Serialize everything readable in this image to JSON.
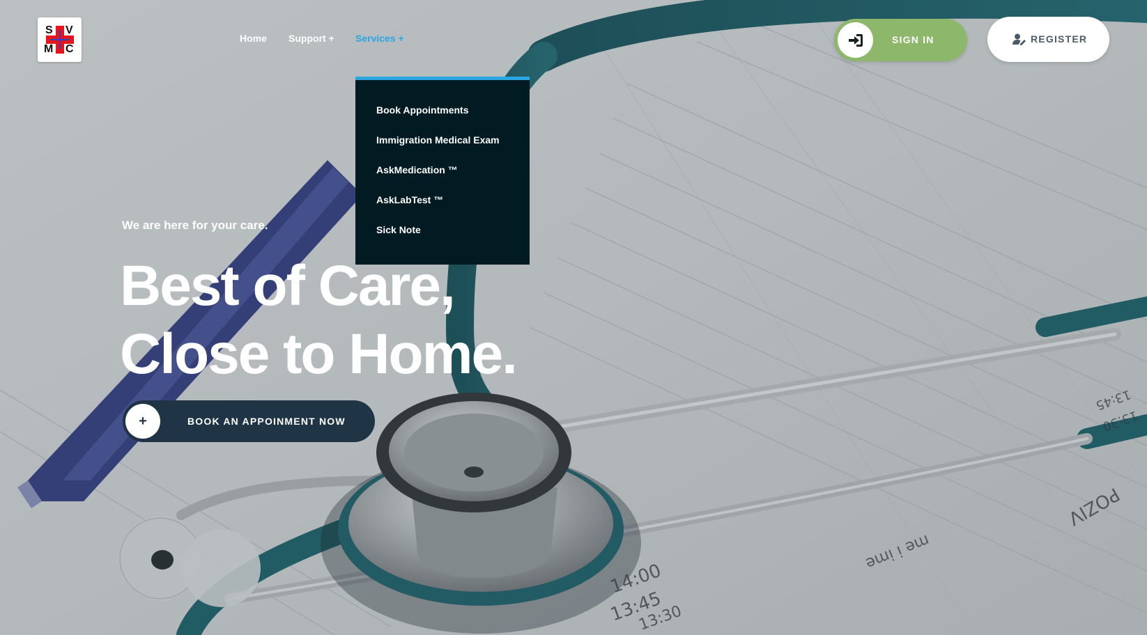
{
  "logo": {
    "letters": [
      "S",
      "V",
      "M",
      "C"
    ]
  },
  "nav": {
    "items": [
      {
        "label": "Home"
      },
      {
        "label": "Support +"
      },
      {
        "label": "Services +"
      }
    ],
    "active_color": "#2aa6e3"
  },
  "services_menu": {
    "items": [
      {
        "label": "Book Appointments"
      },
      {
        "label": "Immigration Medical Exam"
      },
      {
        "label": "AskMedication ™"
      },
      {
        "label": "AskLabTest ™"
      },
      {
        "label": "Sick Note"
      }
    ],
    "background": "#021b23"
  },
  "auth": {
    "signin_label": "SIGN IN",
    "signin_icon": "sign-in-icon",
    "signin_color": "#8db86c",
    "register_label": "REGISTER",
    "register_icon": "user-edit-icon"
  },
  "hero": {
    "tagline": "We are here for your care.",
    "headline_line1": "Best of Care,",
    "headline_line2": "Close to Home.",
    "cta_label": "BOOK AN APPOINMENT NOW",
    "cta_icon_glyph": "+",
    "cta_color": "#1f3445"
  },
  "background_image": {
    "subject": "stethoscope-icon",
    "printed_text": [
      "14:00",
      "13:45",
      "13:30",
      "me i ime",
      "POZIV",
      "13:45",
      "13:30"
    ]
  }
}
